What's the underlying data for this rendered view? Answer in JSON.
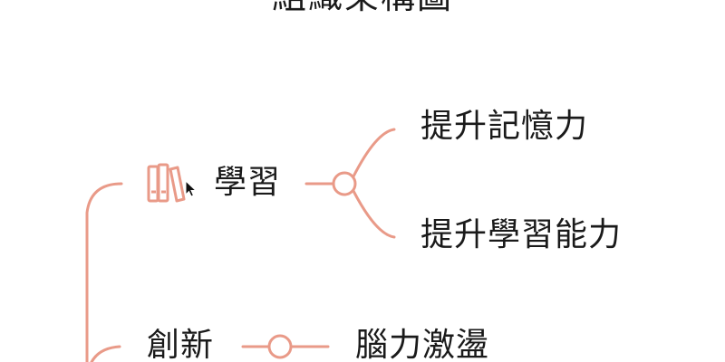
{
  "diagram": {
    "title": "組織架構圖",
    "accent_color": "#e99a88",
    "root_branches": [
      {
        "label": "學習",
        "icon": "books-icon",
        "children": [
          {
            "label": "提升記憶力"
          },
          {
            "label": "提升學習能力"
          }
        ]
      },
      {
        "label": "創新",
        "children": [
          {
            "label": "腦力激盪"
          }
        ]
      }
    ]
  }
}
